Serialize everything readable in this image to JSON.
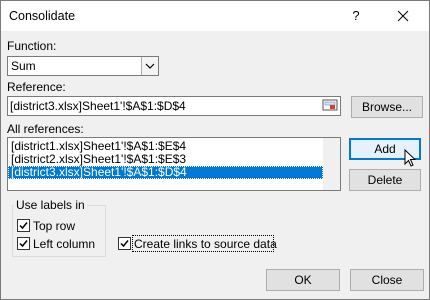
{
  "dialog": {
    "title": "Consolidate",
    "help_label": "?"
  },
  "function": {
    "label": "Function:",
    "value": "Sum"
  },
  "reference": {
    "label": "Reference:",
    "value": "[district3.xlsx]Sheet1'!$A$1:$D$4",
    "browse_label": "Browse..."
  },
  "all_references": {
    "label": "All references:",
    "items": [
      "[district1.xlsx]Sheet1'!$A$1:$E$4",
      "[district2.xlsx]Sheet1'!$A$1:$E$3",
      "[district3.xlsx]Sheet1'!$A$1:$D$4"
    ],
    "selected_index": 2,
    "add_label": "Add",
    "delete_label": "Delete"
  },
  "use_labels": {
    "title": "Use labels in",
    "top_row": {
      "label": "Top row",
      "checked": true
    },
    "left_column": {
      "label": "Left column",
      "checked": true
    }
  },
  "create_links": {
    "label": "Create links to source data",
    "checked": true
  },
  "buttons": {
    "ok": "OK",
    "close": "Close"
  },
  "colors": {
    "accent": "#0078d7",
    "face": "#f0f0f0",
    "button": "#e1e1e1"
  }
}
